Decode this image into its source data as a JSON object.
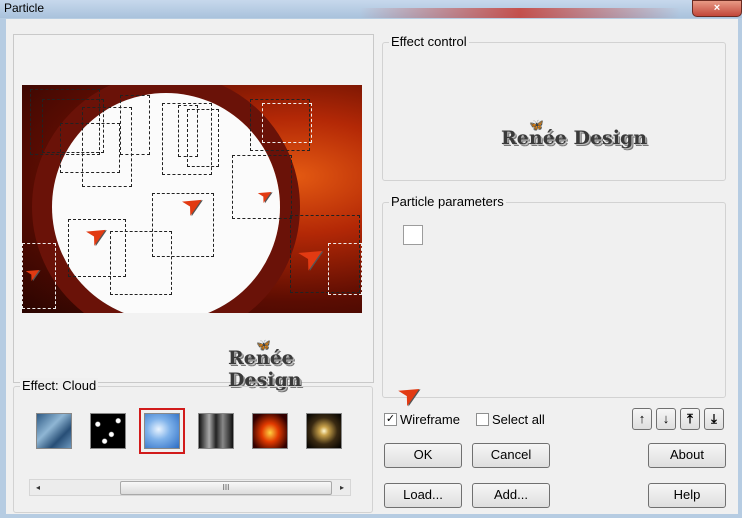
{
  "window": {
    "title": "Particle",
    "close_symbol": "×"
  },
  "watermark": {
    "text": "Renée Design"
  },
  "effect": {
    "label": "Effect: Cloud",
    "thumbnails": [
      {
        "name": "blue-texture",
        "selected": false
      },
      {
        "name": "black-dots",
        "selected": false
      },
      {
        "name": "cloud",
        "selected": true
      },
      {
        "name": "gray-smoke",
        "selected": false
      },
      {
        "name": "fire",
        "selected": false
      },
      {
        "name": "starburst",
        "selected": false
      }
    ],
    "scroll_left": "◂",
    "scroll_right": "▸",
    "scroll_grip": "III"
  },
  "effect_control": {
    "label": "Effect control"
  },
  "particle_parameters": {
    "label": "Particle parameters"
  },
  "options": {
    "wireframe_label": "Wireframe",
    "wireframe_checked": true,
    "wireframe_mark": "✓",
    "select_all_label": "Select all",
    "select_all_checked": false
  },
  "buttons": {
    "ok": "OK",
    "cancel": "Cancel",
    "about": "About",
    "load": "Load...",
    "add": "Add...",
    "help": "Help"
  },
  "order_buttons": {
    "up": "↑",
    "down": "↓",
    "top": "⤒",
    "bottom": "⤓"
  }
}
